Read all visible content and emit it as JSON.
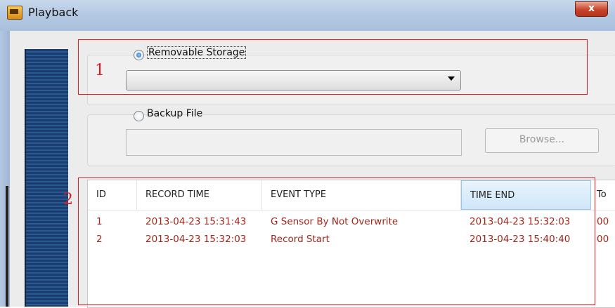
{
  "window": {
    "title": "Playback",
    "close_glyph": "x"
  },
  "storage": {
    "removable_label": "Removable Storage",
    "removable_selected": true,
    "combo_value": "",
    "backup_label": "Backup File",
    "backup_selected": false,
    "backup_path": "",
    "browse_label": "Browse..."
  },
  "table": {
    "columns": [
      "ID",
      "RECORD TIME",
      "EVENT TYPE",
      "TIME END",
      "To"
    ],
    "sorted_column": "TIME END",
    "rows": [
      {
        "id": "1",
        "record_time": "2013-04-23 15:31:43",
        "event_type": "G Sensor By Not Overwrite",
        "time_end": "2013-04-23 15:32:03",
        "to": "00"
      },
      {
        "id": "2",
        "record_time": "2013-04-23 15:32:03",
        "event_type": "Record Start",
        "time_end": "2013-04-23 15:40:40",
        "to": "00"
      }
    ]
  },
  "annotations": {
    "one": "1",
    "two": "2"
  },
  "colors": {
    "row_text": "#a3261b",
    "annotation": "#e0191e"
  }
}
